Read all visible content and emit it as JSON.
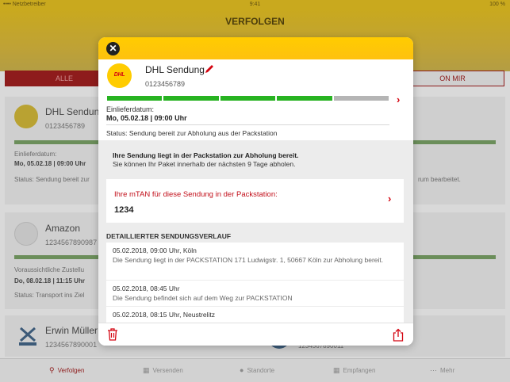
{
  "statusbar": {
    "carrier": "•••• Netzbetreiber",
    "time": "9:41",
    "battery": "100 %"
  },
  "app": {
    "title": "VERFOLGEN"
  },
  "segments": {
    "left": "ALLE",
    "right": "ON MIR"
  },
  "background_list": [
    {
      "name": "DHL Sendung",
      "number": "0123456789",
      "label": "Einlieferdatum:",
      "value": "Mo, 05.02.18 | 09:00 Uhr",
      "status": "Status: Sendung bereit zur",
      "tail": "rum bearbeitet."
    },
    {
      "name": "Amazon",
      "number": "1234567890987",
      "label": "Voraussichtliche Zustellu",
      "value": "Do, 08.02.18 | 11:15 Uhr",
      "status": "Status: Transport ins Ziel"
    },
    {
      "name": "Erwin Müller",
      "number": "1234567890001",
      "extra_number": "1234567890011"
    }
  ],
  "tabs": [
    {
      "label": "Verfolgen",
      "icon": "search-icon",
      "active": true
    },
    {
      "label": "Versenden",
      "icon": "cart-icon"
    },
    {
      "label": "Standorte",
      "icon": "pin-icon"
    },
    {
      "label": "Empfangen",
      "icon": "inbox-icon"
    },
    {
      "label": "Mehr",
      "icon": "more-icon"
    }
  ],
  "modal": {
    "logo_text": "DHL",
    "title": "DHL Sendung",
    "number": "0123456789",
    "progress_steps_done": 4,
    "progress_steps_total": 5,
    "einlieferdatum_label": "Einlieferdatum:",
    "einlieferdatum_value": "Mo, 05.02.18 | 09:00 Uhr",
    "status": "Status: Sendung bereit zur Abholung aus der Packstation",
    "info_bold": "Ihre Sendung liegt in der Packstation zur Abholung bereit.",
    "info_text": "Sie können Ihr Paket innerhalb der nächsten 9 Tage abholen.",
    "mtan_label": "Ihre mTAN für diese Sendung in der Packstation:",
    "mtan_value": "1234",
    "history_title": "DETAILLIERTER SENDUNGSVERLAUF",
    "history": [
      {
        "time": "05.02.2018, 09:00 Uhr, Köln",
        "text": "Die Sendung liegt in der PACKSTATION 171 Ludwigstr. 1, 50667 Köln zur Abholung bereit."
      },
      {
        "time": "05.02.2018, 08:45 Uhr",
        "text": "Die Sendung befindet sich auf dem Weg zur PACKSTATION"
      },
      {
        "time": "05.02.2018, 08:15 Uhr, Neustrelitz",
        "text": ""
      }
    ]
  },
  "colors": {
    "dhl_yellow": "#ffcc00",
    "dhl_red": "#d40511",
    "progress_green": "#27b321",
    "progress_gray": "#b5b5b5"
  }
}
